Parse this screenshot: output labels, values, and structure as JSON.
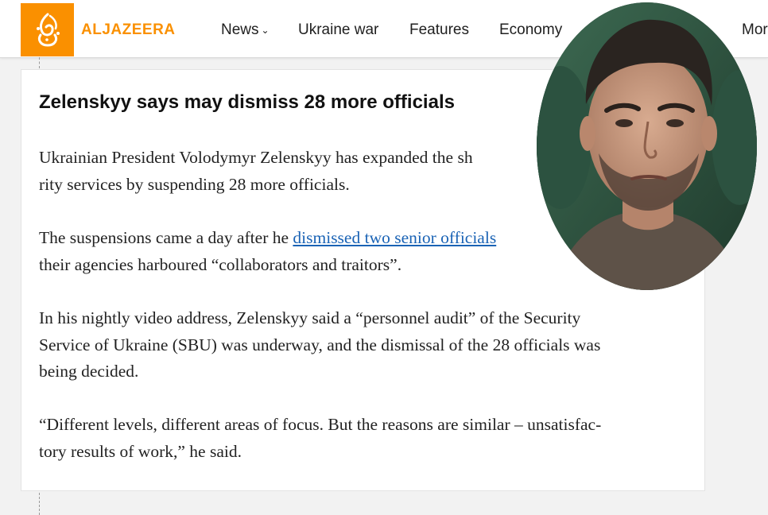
{
  "brand": {
    "name": "ALJAZEERA",
    "color": "#fa9000",
    "logo_icon": "aljazeera-calligraphy-logo"
  },
  "nav": {
    "items": [
      {
        "label": "News",
        "has_dropdown": true
      },
      {
        "label": "Ukraine war"
      },
      {
        "label": "Features"
      },
      {
        "label": "Economy"
      },
      {
        "label": "Mor"
      }
    ],
    "caret": "⌄"
  },
  "article": {
    "headline": "Zelenskyy says may dismiss 28 more officials",
    "paragraphs": [
      {
        "lines": [
          "Ukrainian President Volodymyr Zelenskyy has expanded the sh",
          "rity services by suspending 28 more officials."
        ]
      },
      {
        "line1_before": "The suspensions came a day after he ",
        "line1_link": "dismissed two senior officials",
        "line2": "their agencies harboured “collaborators and traitors”."
      },
      {
        "lines": [
          "In his nightly video address, Zelenskyy said a “personnel audit” of the Security",
          "Service of Ukraine (SBU) was underway, and the dismissal of the 28 officials was",
          "being decided."
        ]
      },
      {
        "lines": [
          "“Different levels, different areas of focus. But the reasons are similar – unsatisfac-",
          "tory results of work,” he said."
        ]
      }
    ],
    "link_color": "#1a63b5"
  },
  "overlay": {
    "portrait_icon": "zelenskyy-portrait-photo"
  }
}
